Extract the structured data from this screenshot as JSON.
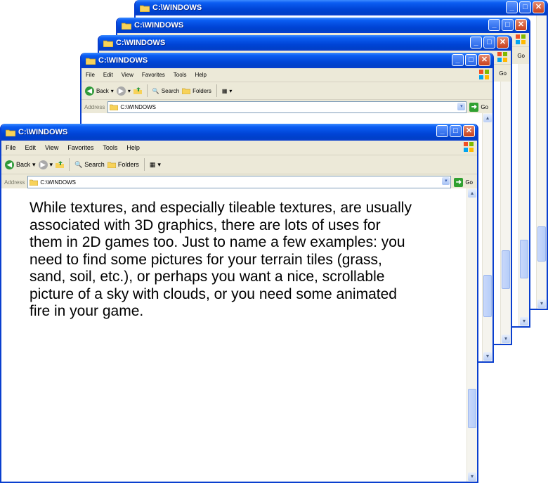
{
  "window": {
    "title": "C:\\WINDOWS",
    "menu": [
      "File",
      "Edit",
      "View",
      "Favorites",
      "Tools",
      "Help"
    ],
    "toolbar": {
      "back": "Back",
      "search": "Search",
      "folders": "Folders"
    },
    "address": {
      "label": "Address",
      "value": "C:\\WINDOWS",
      "go": "Go"
    }
  },
  "content": {
    "text": "While textures, and especially tileable textures, are usually associated with 3D graphics, there are lots of uses for them in 2D games too. Just to name a few examples: you need to find some pictures for your terrain tiles (grass, sand, soil, etc.), or perhaps you want a nice, scrollable picture of a sky with clouds, or you need some animated fire in your game."
  },
  "colors": {
    "titlebar": "#0b5df2",
    "close": "#c8401c",
    "frame": "#ece9d8"
  },
  "icons": [
    "folder-icon",
    "minimize-icon",
    "maximize-icon",
    "close-icon",
    "windows-logo-icon",
    "back-icon",
    "forward-icon",
    "up-folder-icon",
    "search-icon",
    "folders-icon",
    "views-icon",
    "go-icon"
  ]
}
